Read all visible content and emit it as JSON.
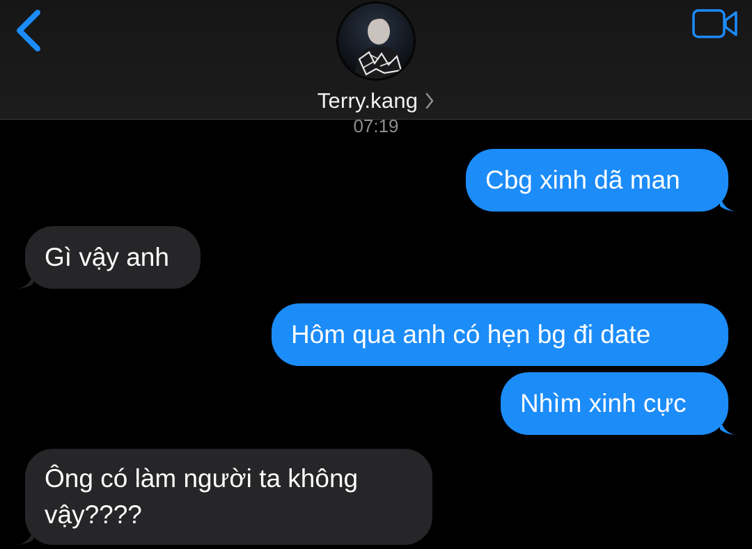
{
  "header": {
    "contact_name": "Terry.kang",
    "back_icon": "chevron-left-icon",
    "video_icon": "video-camera-icon",
    "avatar": "contact-avatar"
  },
  "timestamp": "07:19",
  "colors": {
    "accent": "#1c8cf9",
    "sent_bubble": "#1c8cf9",
    "received_bubble": "#262628",
    "background": "#000000",
    "timestamp": "#8e8e93"
  },
  "messages": [
    {
      "direction": "sent",
      "text": "Cbg xinh dã man"
    },
    {
      "direction": "received",
      "text": "Gì vậy anh"
    },
    {
      "direction": "sent",
      "text": "Hôm qua anh có hẹn bg đi date"
    },
    {
      "direction": "sent",
      "text": "Nhìm xinh cực"
    },
    {
      "direction": "received",
      "text": "Ông có làm người ta không vậy????"
    }
  ]
}
